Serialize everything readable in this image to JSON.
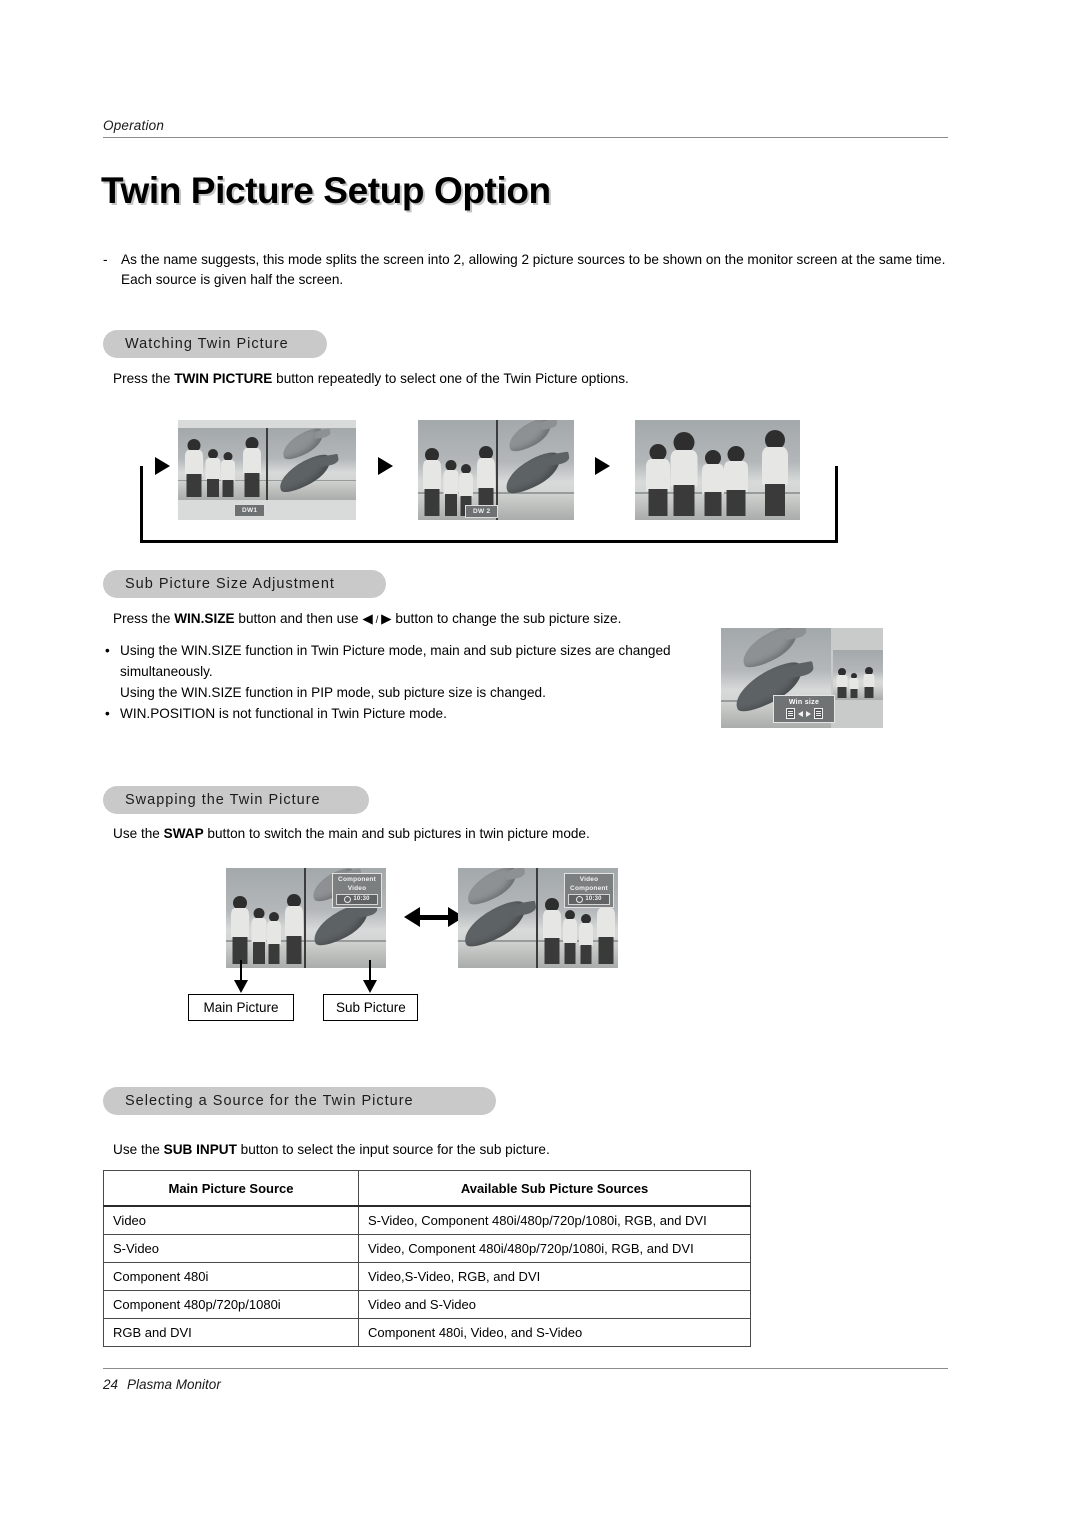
{
  "header": {
    "running_head": "Operation"
  },
  "title": "Twin Picture Setup Option",
  "intro": {
    "dash": "-",
    "text": "As the name suggests, this mode splits the screen into 2, allowing 2 picture sources to be shown on the monitor screen at the same time. Each source is given half the screen."
  },
  "sections": [
    {
      "id": "watching",
      "heading": "Watching Twin Picture",
      "instruction_pre": "Press the ",
      "instruction_bold": "TWIN PICTURE",
      "instruction_post": " button repeatedly to select one of the Twin Picture options.",
      "diagram": {
        "screen1_tag": "DW1",
        "screen2_tag": "DW 2"
      }
    },
    {
      "id": "subsize",
      "heading": "Sub Picture Size Adjustment",
      "instruction_pre": "Press the ",
      "instruction_bold": "WIN.SIZE",
      "instruction_mid": " button and then use ",
      "arrow_left": "◀",
      "arrow_slash": " / ",
      "arrow_right": "▶",
      "instruction_post": " button to change the sub picture size.",
      "bullets": [
        "Using the WIN.SIZE function in Twin Picture mode, main and sub picture sizes are changed simultaneously.",
        "Using the WIN.SIZE function in PIP mode, sub picture size is changed.",
        "WIN.POSITION is not functional in Twin Picture mode."
      ],
      "osd": {
        "title": "Win size",
        "clock": ""
      }
    },
    {
      "id": "swapping",
      "heading": "Swapping the Twin Picture",
      "instruction_pre": "Use the ",
      "instruction_bold": "SWAP",
      "instruction_post": " button to switch the main and sub pictures in twin picture mode.",
      "osd_left": {
        "line1": "Component",
        "line2": "Video",
        "clock": "10:30"
      },
      "osd_right": {
        "line1": "Video",
        "line2": "Component",
        "clock": "10:30"
      },
      "callouts": {
        "main": "Main Picture",
        "sub": "Sub Picture"
      }
    },
    {
      "id": "selecting",
      "heading": "Selecting a Source for the Twin Picture",
      "instruction_pre": "Use the ",
      "instruction_bold": "SUB INPUT",
      "instruction_post": " button to select the input source for the sub picture."
    }
  ],
  "table": {
    "columns": [
      "Main Picture Source",
      "Available Sub Picture Sources"
    ],
    "rows": [
      [
        "Video",
        "S-Video, Component 480i/480p/720p/1080i, RGB, and DVI"
      ],
      [
        "S-Video",
        "Video, Component 480i/480p/720p/1080i, RGB, and DVI"
      ],
      [
        "Component 480i",
        "Video,S-Video, RGB, and DVI"
      ],
      [
        "Component 480p/720p/1080i",
        "Video and S-Video"
      ],
      [
        "RGB and DVI",
        "Component 480i, Video, and S-Video"
      ]
    ]
  },
  "footer": {
    "page_number": "24",
    "document_name": "Plasma Monitor"
  }
}
